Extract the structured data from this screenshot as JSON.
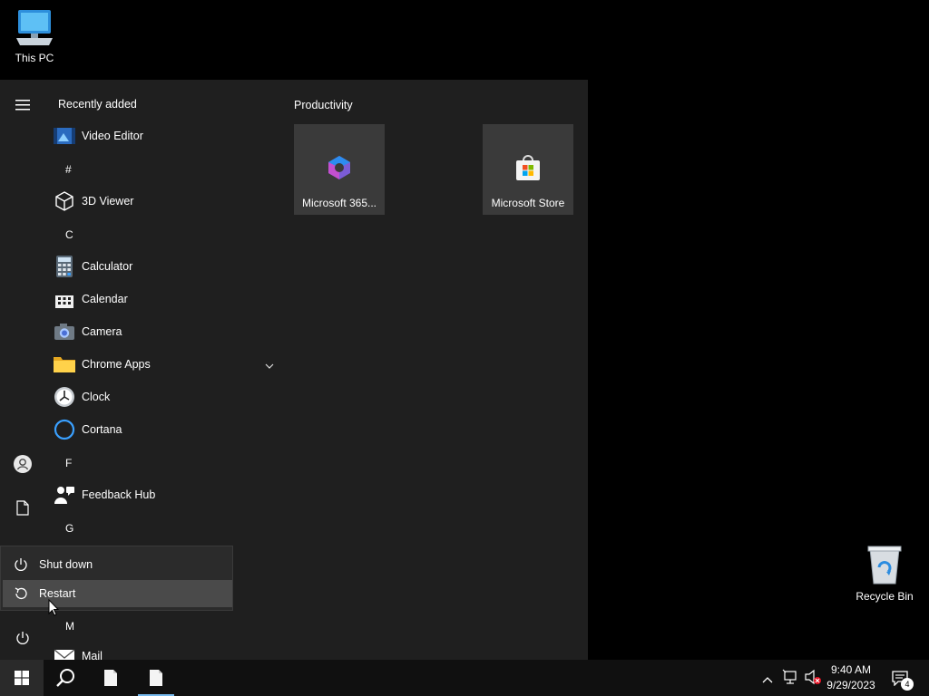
{
  "desktop": {
    "this_pc_label": "This PC",
    "recycle_bin_label": "Recycle Bin"
  },
  "start_menu": {
    "recently_added_header": "Recently added",
    "apps": {
      "video_editor": "Video Editor",
      "hash": "#",
      "viewer_3d": "3D Viewer",
      "c": "C",
      "calculator": "Calculator",
      "calendar": "Calendar",
      "camera": "Camera",
      "chrome_apps": "Chrome Apps",
      "clock": "Clock",
      "cortana": "Cortana",
      "f": "F",
      "feedback_hub": "Feedback Hub",
      "g": "G",
      "m": "M",
      "mail": "Mail"
    },
    "tiles_group": "Productivity",
    "tiles": {
      "m365": "Microsoft 365...",
      "store": "Microsoft Store"
    },
    "power_menu": {
      "shutdown": "Shut down",
      "restart": "Restart"
    }
  },
  "taskbar": {
    "time": "9:40 AM",
    "date": "9/29/2023",
    "notification_count": "4"
  },
  "colors": {
    "accent": "#76b9ed",
    "start_bg": "#1f1f1f",
    "tile_bg": "#3a3a3a",
    "highlight": "#4a4a4a"
  }
}
